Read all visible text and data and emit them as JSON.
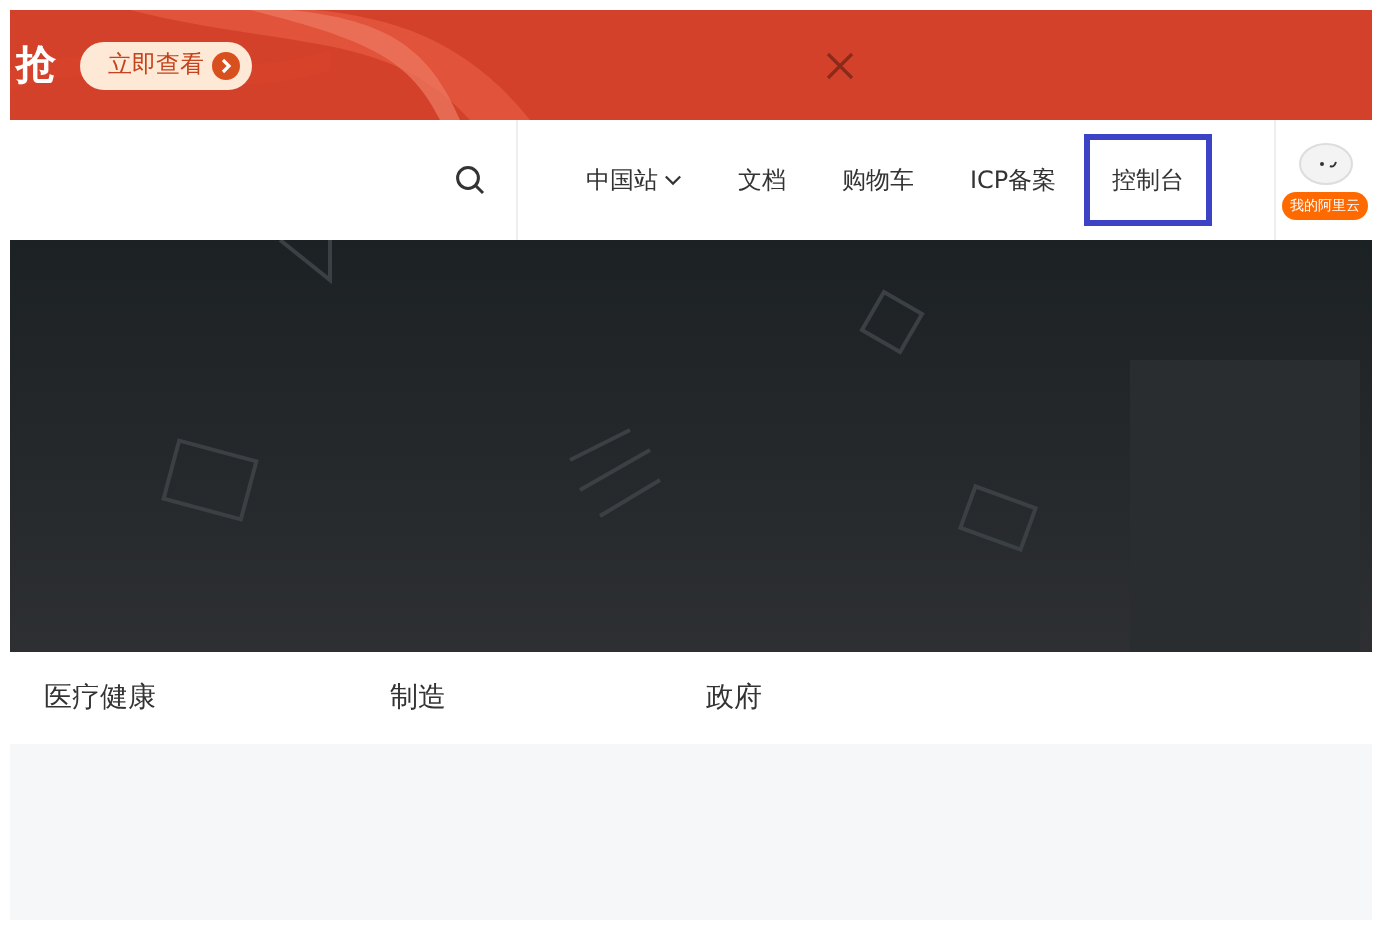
{
  "promo_banner": {
    "title": "抢",
    "button": "立即查看"
  },
  "header": {
    "nav": [
      {
        "label": "中国站",
        "dropdown": true,
        "highlighted": false
      },
      {
        "label": "文档",
        "dropdown": false,
        "highlighted": false
      },
      {
        "label": "购物车",
        "dropdown": false,
        "highlighted": false
      },
      {
        "label": "ICP备案",
        "dropdown": false,
        "highlighted": false
      },
      {
        "label": "控制台",
        "dropdown": false,
        "highlighted": true
      }
    ],
    "account_badge": "我的阿里云"
  },
  "industries": [
    "医疗健康",
    "制造",
    "政府"
  ]
}
